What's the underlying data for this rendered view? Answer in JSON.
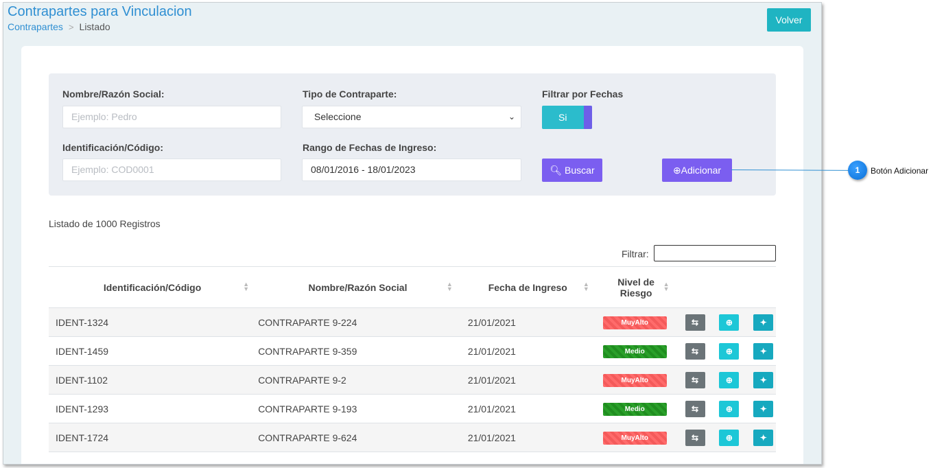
{
  "header": {
    "title": "Contrapartes para Vinculacion",
    "breadcrumb": [
      "Contrapartes",
      "Listado"
    ],
    "back_label": "Volver"
  },
  "filters": {
    "name_label": "Nombre/Razón Social:",
    "name_placeholder": "Ejemplo: Pedro",
    "type_label": "Tipo de Contraparte:",
    "type_selected": "Seleccione",
    "date_filter_label": "Filtrar por Fechas",
    "date_filter_value": "Si",
    "id_label": "Identificación/Código:",
    "id_placeholder": "Ejemplo: COD0001",
    "range_label": "Rango de Fechas de Ingreso:",
    "range_value": "08/01/2016 - 18/01/2023",
    "search_label": "Buscar",
    "add_label": "Adicionar"
  },
  "list": {
    "count_text": "Listado de 1000 Registros",
    "filter_label": "Filtrar:",
    "columns": [
      "Identificación/Código",
      "Nombre/Razón Social",
      "Fecha de Ingreso",
      "Nivel de Riesgo"
    ],
    "rows": [
      {
        "id": "IDENT-1324",
        "name": "CONTRAPARTE 9-224",
        "date": "21/01/2021",
        "risk": "MuyAlto"
      },
      {
        "id": "IDENT-1459",
        "name": "CONTRAPARTE 9-359",
        "date": "21/01/2021",
        "risk": "Medio"
      },
      {
        "id": "IDENT-1102",
        "name": "CONTRAPARTE 9-2",
        "date": "21/01/2021",
        "risk": "MuyAlto"
      },
      {
        "id": "IDENT-1293",
        "name": "CONTRAPARTE 9-193",
        "date": "21/01/2021",
        "risk": "Medio"
      },
      {
        "id": "IDENT-1724",
        "name": "CONTRAPARTE 9-624",
        "date": "21/01/2021",
        "risk": "MuyAlto"
      }
    ]
  },
  "callout": {
    "number": "1",
    "text": "Botón Adicionar"
  },
  "colors": {
    "accent_cyan": "#1fb4c2",
    "accent_purple": "#7b5ef0",
    "risk_high": "#ff6b6b",
    "risk_medium": "#2aa02a"
  }
}
